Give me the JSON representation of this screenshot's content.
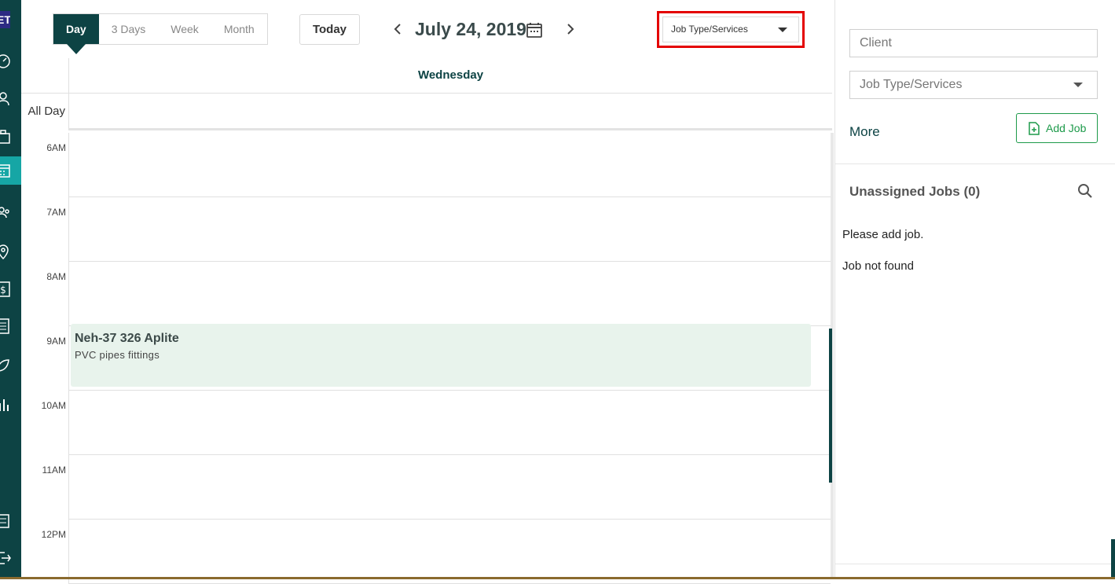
{
  "rail": {
    "logo_text": "ET",
    "items": [
      {
        "name": "dashboard-icon"
      },
      {
        "name": "person-icon"
      },
      {
        "name": "briefcase-icon"
      },
      {
        "name": "calendar-icon",
        "active": true
      },
      {
        "name": "team-icon"
      },
      {
        "name": "map-pin-icon"
      },
      {
        "name": "dollar-icon"
      },
      {
        "name": "document-icon"
      },
      {
        "name": "leaf-icon"
      },
      {
        "name": "bar-chart-icon"
      },
      {
        "name": "settings-list-icon"
      },
      {
        "name": "logout-icon"
      }
    ]
  },
  "toolbar": {
    "views": [
      "Day",
      "3 Days",
      "Week",
      "Month"
    ],
    "active_view": "Day",
    "today_label": "Today",
    "date_title": "July 24, 2019",
    "job_type_label": "Job Type/Services"
  },
  "calendar": {
    "day_name": "Wednesday",
    "all_day_label": "All Day",
    "hours": [
      "6AM",
      "7AM",
      "8AM",
      "9AM",
      "10AM",
      "11AM",
      "12PM"
    ],
    "event": {
      "title": "Neh-37 326 Aplite",
      "subtitle": "PVC pipes fittings"
    }
  },
  "panel": {
    "client_placeholder": "Client",
    "job_type_label": "Job Type/Services",
    "more_label": "More",
    "add_job_label": "Add Job",
    "unassigned_title": "Unassigned Jobs (0)",
    "msg_add": "Please add job.",
    "msg_not_found": "Job not found"
  },
  "colors": {
    "primary": "#0d4344",
    "accent": "#16a6a5",
    "green": "#1d9a4a",
    "highlight_border": "#e40000",
    "event_bg": "#e8f3ec"
  }
}
